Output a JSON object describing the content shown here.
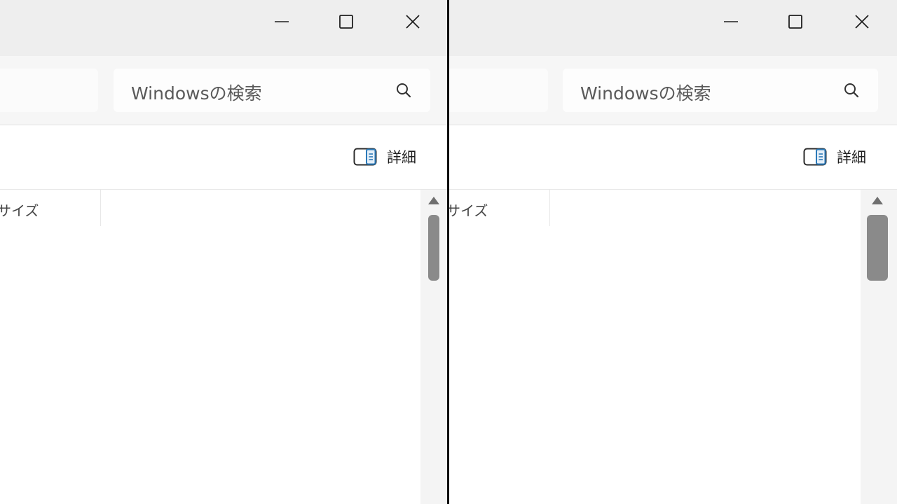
{
  "windows": [
    {
      "search": {
        "placeholder": "Windowsの検索"
      },
      "toolbar": {
        "details_label": "詳細"
      },
      "columns": [
        {
          "label": "サイズ"
        }
      ],
      "icons": {
        "minimize": "minimize-icon",
        "maximize": "maximize-icon",
        "close": "close-icon",
        "search": "search-icon",
        "details": "details-pane-icon"
      }
    },
    {
      "search": {
        "placeholder": "Windowsの検索"
      },
      "toolbar": {
        "details_label": "詳細"
      },
      "columns": [
        {
          "label": "サイズ"
        }
      ],
      "icons": {
        "minimize": "minimize-icon",
        "maximize": "maximize-icon",
        "close": "close-icon",
        "search": "search-icon",
        "details": "details-pane-icon"
      }
    }
  ],
  "colors": {
    "titlebar": "#eeeeee",
    "addressbar": "#f6f6f6",
    "accent": "#2b79b8",
    "divider": "#101010"
  }
}
